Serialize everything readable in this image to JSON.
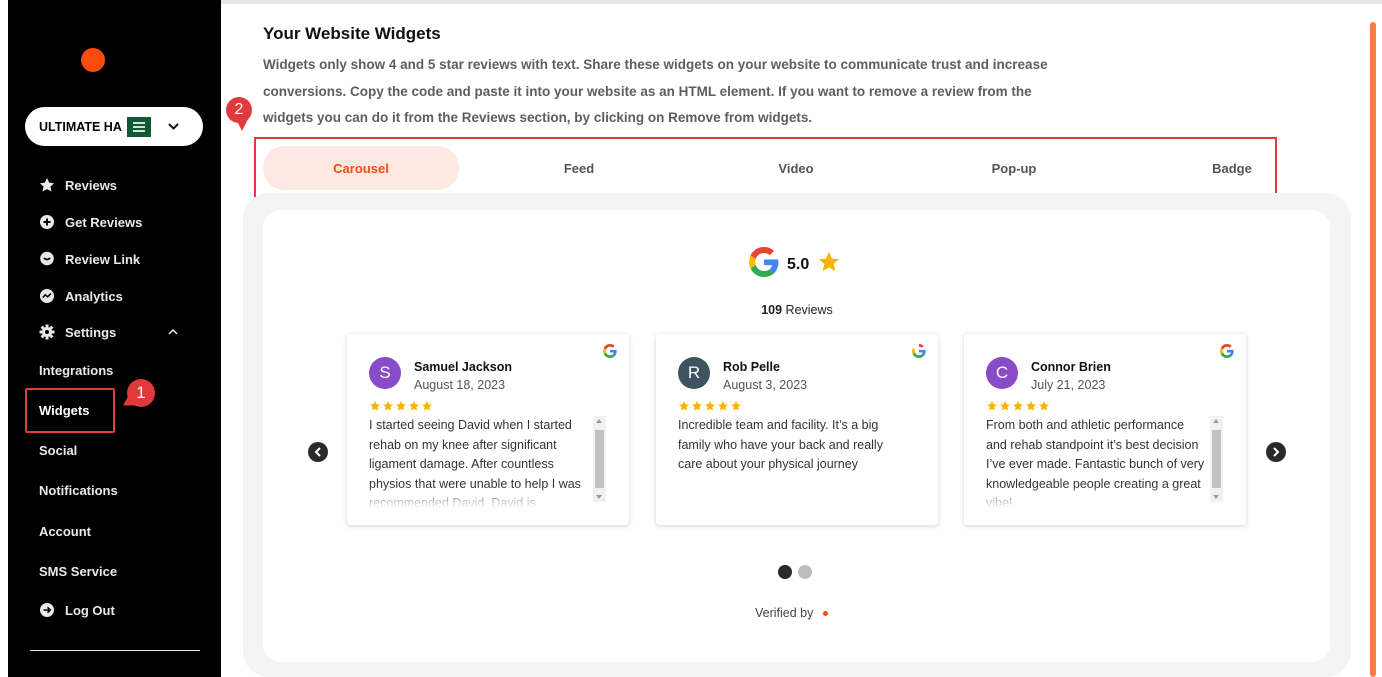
{
  "colors": {
    "accent": "#ff4a0d",
    "sidebar_bg": "#000000",
    "highlight_red": "#e23a3a",
    "active_tab_bg": "#fde9e2",
    "star": "#f5b400",
    "avatar_purple": "#8a4bc9",
    "avatar_slate": "#3e5360"
  },
  "sidebar": {
    "business_name": "ULTIMATE HA",
    "nav": [
      {
        "label": "Reviews",
        "icon": "star-badge-icon"
      },
      {
        "label": "Get Reviews",
        "icon": "plus-circle-icon"
      },
      {
        "label": "Review Link",
        "icon": "chat-bubble-icon"
      },
      {
        "label": "Analytics",
        "icon": "chart-circle-icon"
      },
      {
        "label": "Settings",
        "icon": "gear-icon"
      }
    ],
    "settings_sub": [
      "Integrations",
      "Widgets",
      "Social",
      "Notifications",
      "Account",
      "SMS Service"
    ],
    "logout_label": "Log Out"
  },
  "annotations": {
    "step1": "1",
    "step2": "2"
  },
  "main": {
    "title": "Your Website Widgets",
    "description": "Widgets only show 4 and 5 star reviews with text. Share these widgets on your website to communicate trust and increase conversions. Copy the code and paste it into your website as an HTML element. If you want to remove a review from the widgets you can do it from the Reviews section, by clicking on Remove from widgets.",
    "tabs": [
      "Carousel",
      "Feed",
      "Video",
      "Pop-up",
      "Badge"
    ],
    "active_tab": "Carousel"
  },
  "widget": {
    "rating": "5.0",
    "review_count": "109",
    "reviews_word": "Reviews",
    "verified_label": "Verified by",
    "pagination": {
      "current": 1,
      "total": 2
    },
    "cards": [
      {
        "initial": "S",
        "name": "Samuel Jackson",
        "date": "August 18, 2023",
        "stars": 5,
        "text": "I started seeing David when I started rehab on my knee after significant ligament damage. After countless physios that were unable to help I was recommended David. David is"
      },
      {
        "initial": "R",
        "name": "Rob Pelle",
        "date": "August 3, 2023",
        "stars": 5,
        "text": "Incredible team and facility. It’s a big family who have your back and really care about your physical journey"
      },
      {
        "initial": "C",
        "name": "Connor Brien",
        "date": "July 21, 2023",
        "stars": 5,
        "text": "From both and athletic performance and rehab standpoint it’s best decision I’ve ever made. Fantastic bunch of very knowledgeable people creating a great vibe!"
      }
    ]
  }
}
